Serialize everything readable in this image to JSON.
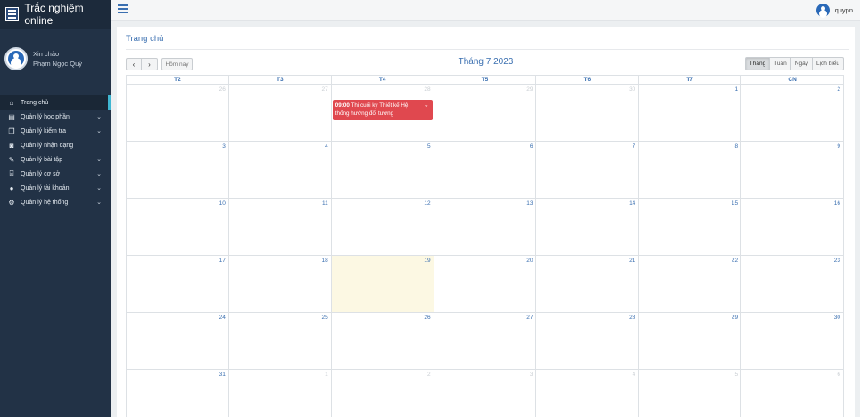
{
  "app": {
    "title": "Trắc nghiệm online"
  },
  "user": {
    "greeting": "Xin chào",
    "full_name": "Phạm Ngọc Quý",
    "username": "quypn"
  },
  "sidebar": {
    "items": [
      {
        "label": "Trang chủ",
        "icon": "home-icon",
        "glyph": "⌂",
        "active": true,
        "has_children": false
      },
      {
        "label": "Quản lý học phần",
        "icon": "book-icon",
        "glyph": "▤",
        "active": false,
        "has_children": true
      },
      {
        "label": "Quản lý kiểm tra",
        "icon": "exam-icon",
        "glyph": "❐",
        "active": false,
        "has_children": true
      },
      {
        "label": "Quản lý nhận dạng",
        "icon": "camera-icon",
        "glyph": "◙",
        "active": false,
        "has_children": false
      },
      {
        "label": "Quản lý bài tập",
        "icon": "edit-icon",
        "glyph": "✎",
        "active": false,
        "has_children": true
      },
      {
        "label": "Quản lý cơ sở",
        "icon": "institution-icon",
        "glyph": "⌸",
        "active": false,
        "has_children": true
      },
      {
        "label": "Quản lý tài khoản",
        "icon": "user-icon",
        "glyph": "●",
        "active": false,
        "has_children": true
      },
      {
        "label": "Quản lý hệ thống",
        "icon": "cogs-icon",
        "glyph": "⚙",
        "active": false,
        "has_children": true
      }
    ]
  },
  "breadcrumb": "Trang chủ",
  "calendar": {
    "title": "Tháng 7 2023",
    "today_label": "Hôm nay",
    "prev_label": "‹",
    "next_label": "›",
    "views": [
      {
        "label": "Tháng",
        "active": true
      },
      {
        "label": "Tuần",
        "active": false
      },
      {
        "label": "Ngày",
        "active": false
      },
      {
        "label": "Lịch biểu",
        "active": false
      }
    ],
    "weekdays": [
      "T2",
      "T3",
      "T4",
      "T5",
      "T6",
      "T7",
      "CN"
    ],
    "weeks": [
      [
        {
          "d": "26",
          "other": true
        },
        {
          "d": "27",
          "other": true
        },
        {
          "d": "28",
          "other": true
        },
        {
          "d": "29",
          "other": true
        },
        {
          "d": "30",
          "other": true
        },
        {
          "d": "1"
        },
        {
          "d": "2"
        }
      ],
      [
        {
          "d": "3"
        },
        {
          "d": "4"
        },
        {
          "d": "5"
        },
        {
          "d": "6"
        },
        {
          "d": "7"
        },
        {
          "d": "8"
        },
        {
          "d": "9"
        }
      ],
      [
        {
          "d": "10"
        },
        {
          "d": "11"
        },
        {
          "d": "12"
        },
        {
          "d": "13"
        },
        {
          "d": "14"
        },
        {
          "d": "15"
        },
        {
          "d": "16"
        }
      ],
      [
        {
          "d": "17"
        },
        {
          "d": "18"
        },
        {
          "d": "19",
          "today": true
        },
        {
          "d": "20"
        },
        {
          "d": "21"
        },
        {
          "d": "22"
        },
        {
          "d": "23"
        }
      ],
      [
        {
          "d": "24"
        },
        {
          "d": "25"
        },
        {
          "d": "26"
        },
        {
          "d": "27"
        },
        {
          "d": "28"
        },
        {
          "d": "29"
        },
        {
          "d": "30"
        }
      ],
      [
        {
          "d": "31"
        },
        {
          "d": "1",
          "other": true
        },
        {
          "d": "2",
          "other": true
        },
        {
          "d": "3",
          "other": true
        },
        {
          "d": "4",
          "other": true
        },
        {
          "d": "5",
          "other": true
        },
        {
          "d": "6",
          "other": true
        }
      ]
    ],
    "event": {
      "time": "09:00",
      "title": "Thi cuối kỳ Thiết kế Hệ thống hướng đối tượng",
      "color": "#e0484f",
      "week": 0,
      "day": 2
    }
  },
  "colors": {
    "sidebar": "#223246",
    "accent": "#3a6fb0",
    "active_marker": "#3fb6d1",
    "today_bg": "#fcf8e3"
  }
}
